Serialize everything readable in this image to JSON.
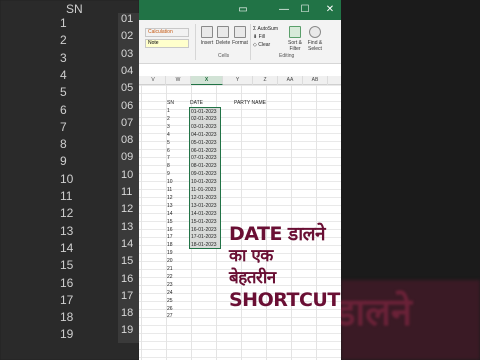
{
  "background": {
    "left_header": "SN",
    "left_numbers": [
      "1",
      "2",
      "3",
      "4",
      "5",
      "6",
      "7",
      "8",
      "9",
      "10",
      "11",
      "12",
      "13",
      "14",
      "15",
      "16",
      "17",
      "18",
      "19"
    ],
    "left_dates": [
      "01",
      "02",
      "03",
      "04",
      "05",
      "06",
      "07",
      "08",
      "09",
      "10",
      "11",
      "12",
      "13",
      "14",
      "15",
      "16",
      "17",
      "18",
      "19"
    ],
    "right_text": "डालने"
  },
  "titlebar": {
    "icons": [
      "ribbon-display-icon",
      "minimize-icon",
      "maximize-icon",
      "close-icon"
    ]
  },
  "ribbon": {
    "styles": {
      "calculation": "Calculation",
      "note": "Note"
    },
    "cells_group": {
      "insert": "Insert",
      "delete": "Delete",
      "format": "Format",
      "label": "Cells"
    },
    "editing_group": {
      "autosum": "AutoSum",
      "fill": "Fill",
      "clear": "Clear",
      "sort_filter": "Sort & Filter",
      "find_select": "Find & Select",
      "label": "Editing"
    }
  },
  "columns": [
    "V",
    "W",
    "X",
    "Y",
    "Z",
    "AA",
    "AB"
  ],
  "selected_column": "X",
  "table": {
    "sn_header": "SN",
    "date_header": "DATE",
    "party_header": "PARTY NAME",
    "sn": [
      "1",
      "2",
      "3",
      "4",
      "5",
      "6",
      "7",
      "8",
      "9",
      "10",
      "11",
      "12",
      "13",
      "14",
      "15",
      "16",
      "17",
      "18",
      "19",
      "20",
      "21",
      "22",
      "23",
      "24",
      "25",
      "26",
      "27"
    ],
    "dates": [
      "01-01-2023",
      "02-01-2023",
      "03-01-2023",
      "04-01-2023",
      "05-01-2023",
      "06-01-2023",
      "07-01-2023",
      "08-01-2023",
      "09-01-2023",
      "10-01-2023",
      "11-01-2023",
      "12-01-2023",
      "13-01-2023",
      "14-01-2023",
      "15-01-2023",
      "16-01-2023",
      "17-01-2023",
      "18-01-2023"
    ]
  },
  "overlay": {
    "line1": "DATE डालने",
    "line2": "का एक",
    "line3": "बेहतरीन",
    "line4": "SHORTCUT"
  },
  "colors": {
    "excel_green": "#217346",
    "overlay_text": "#6a0f34",
    "selection": "#d9dbd9"
  }
}
